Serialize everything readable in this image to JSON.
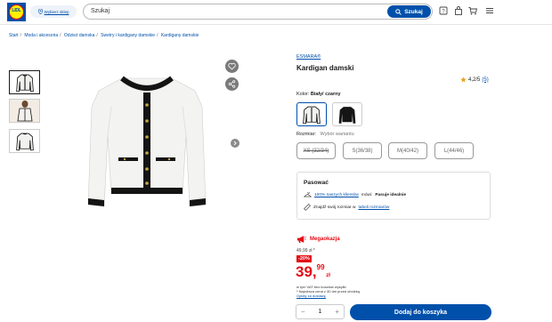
{
  "header": {
    "logo_text": "LIDL",
    "store_label": "Wybierz sklep",
    "search_placeholder": "Szukaj",
    "search_button": "Szukaj",
    "icons": [
      "question-icon",
      "bag-icon",
      "cart-icon",
      "menu-icon"
    ]
  },
  "breadcrumb": [
    "Start",
    "Moda i akcesoria",
    "Odzież damska",
    "Swetry i kardigany damskie",
    "Kardigany damskie"
  ],
  "product": {
    "brand": "ESMARA®",
    "title": "Kardigan damski",
    "rating": "4,2/5",
    "rating_count": "(5)",
    "color_label": "Kolor:",
    "color_value": "Biały/ czarny",
    "size_label": "Rozmiar:",
    "size_hint": "Wybór wariantu",
    "sizes": [
      "XS (32/34)",
      "S(36/38)",
      "M(40/42)",
      "L(44/46)"
    ]
  },
  "fit": {
    "heading": "Pasować",
    "row1_link": "100% naszych klientów",
    "row1_text": "mówi:",
    "row1_bold": "Pasuje idealnie",
    "row2_text": "Znajdź swój rozmiar w",
    "row2_link": "tabeli rozmiarów"
  },
  "price": {
    "badge": "Megaokazja",
    "old": "49,99 zł *",
    "discount": "-20%",
    "main": "39,",
    "fraction": "99",
    "currency": "zł",
    "vat_line1": "w tym VAT bez kosztów wysyłki",
    "vat_line2": "* Najniższa cena z 30 dni przed obniżką",
    "delivery_link": "Opłaty za dostawę"
  },
  "cart": {
    "quantity": "1",
    "minus": "−",
    "plus": "+",
    "add_label": "Dodaj do koszyka"
  },
  "colors": {
    "brand_blue": "#0050aa",
    "sale_red": "#e60a14"
  }
}
